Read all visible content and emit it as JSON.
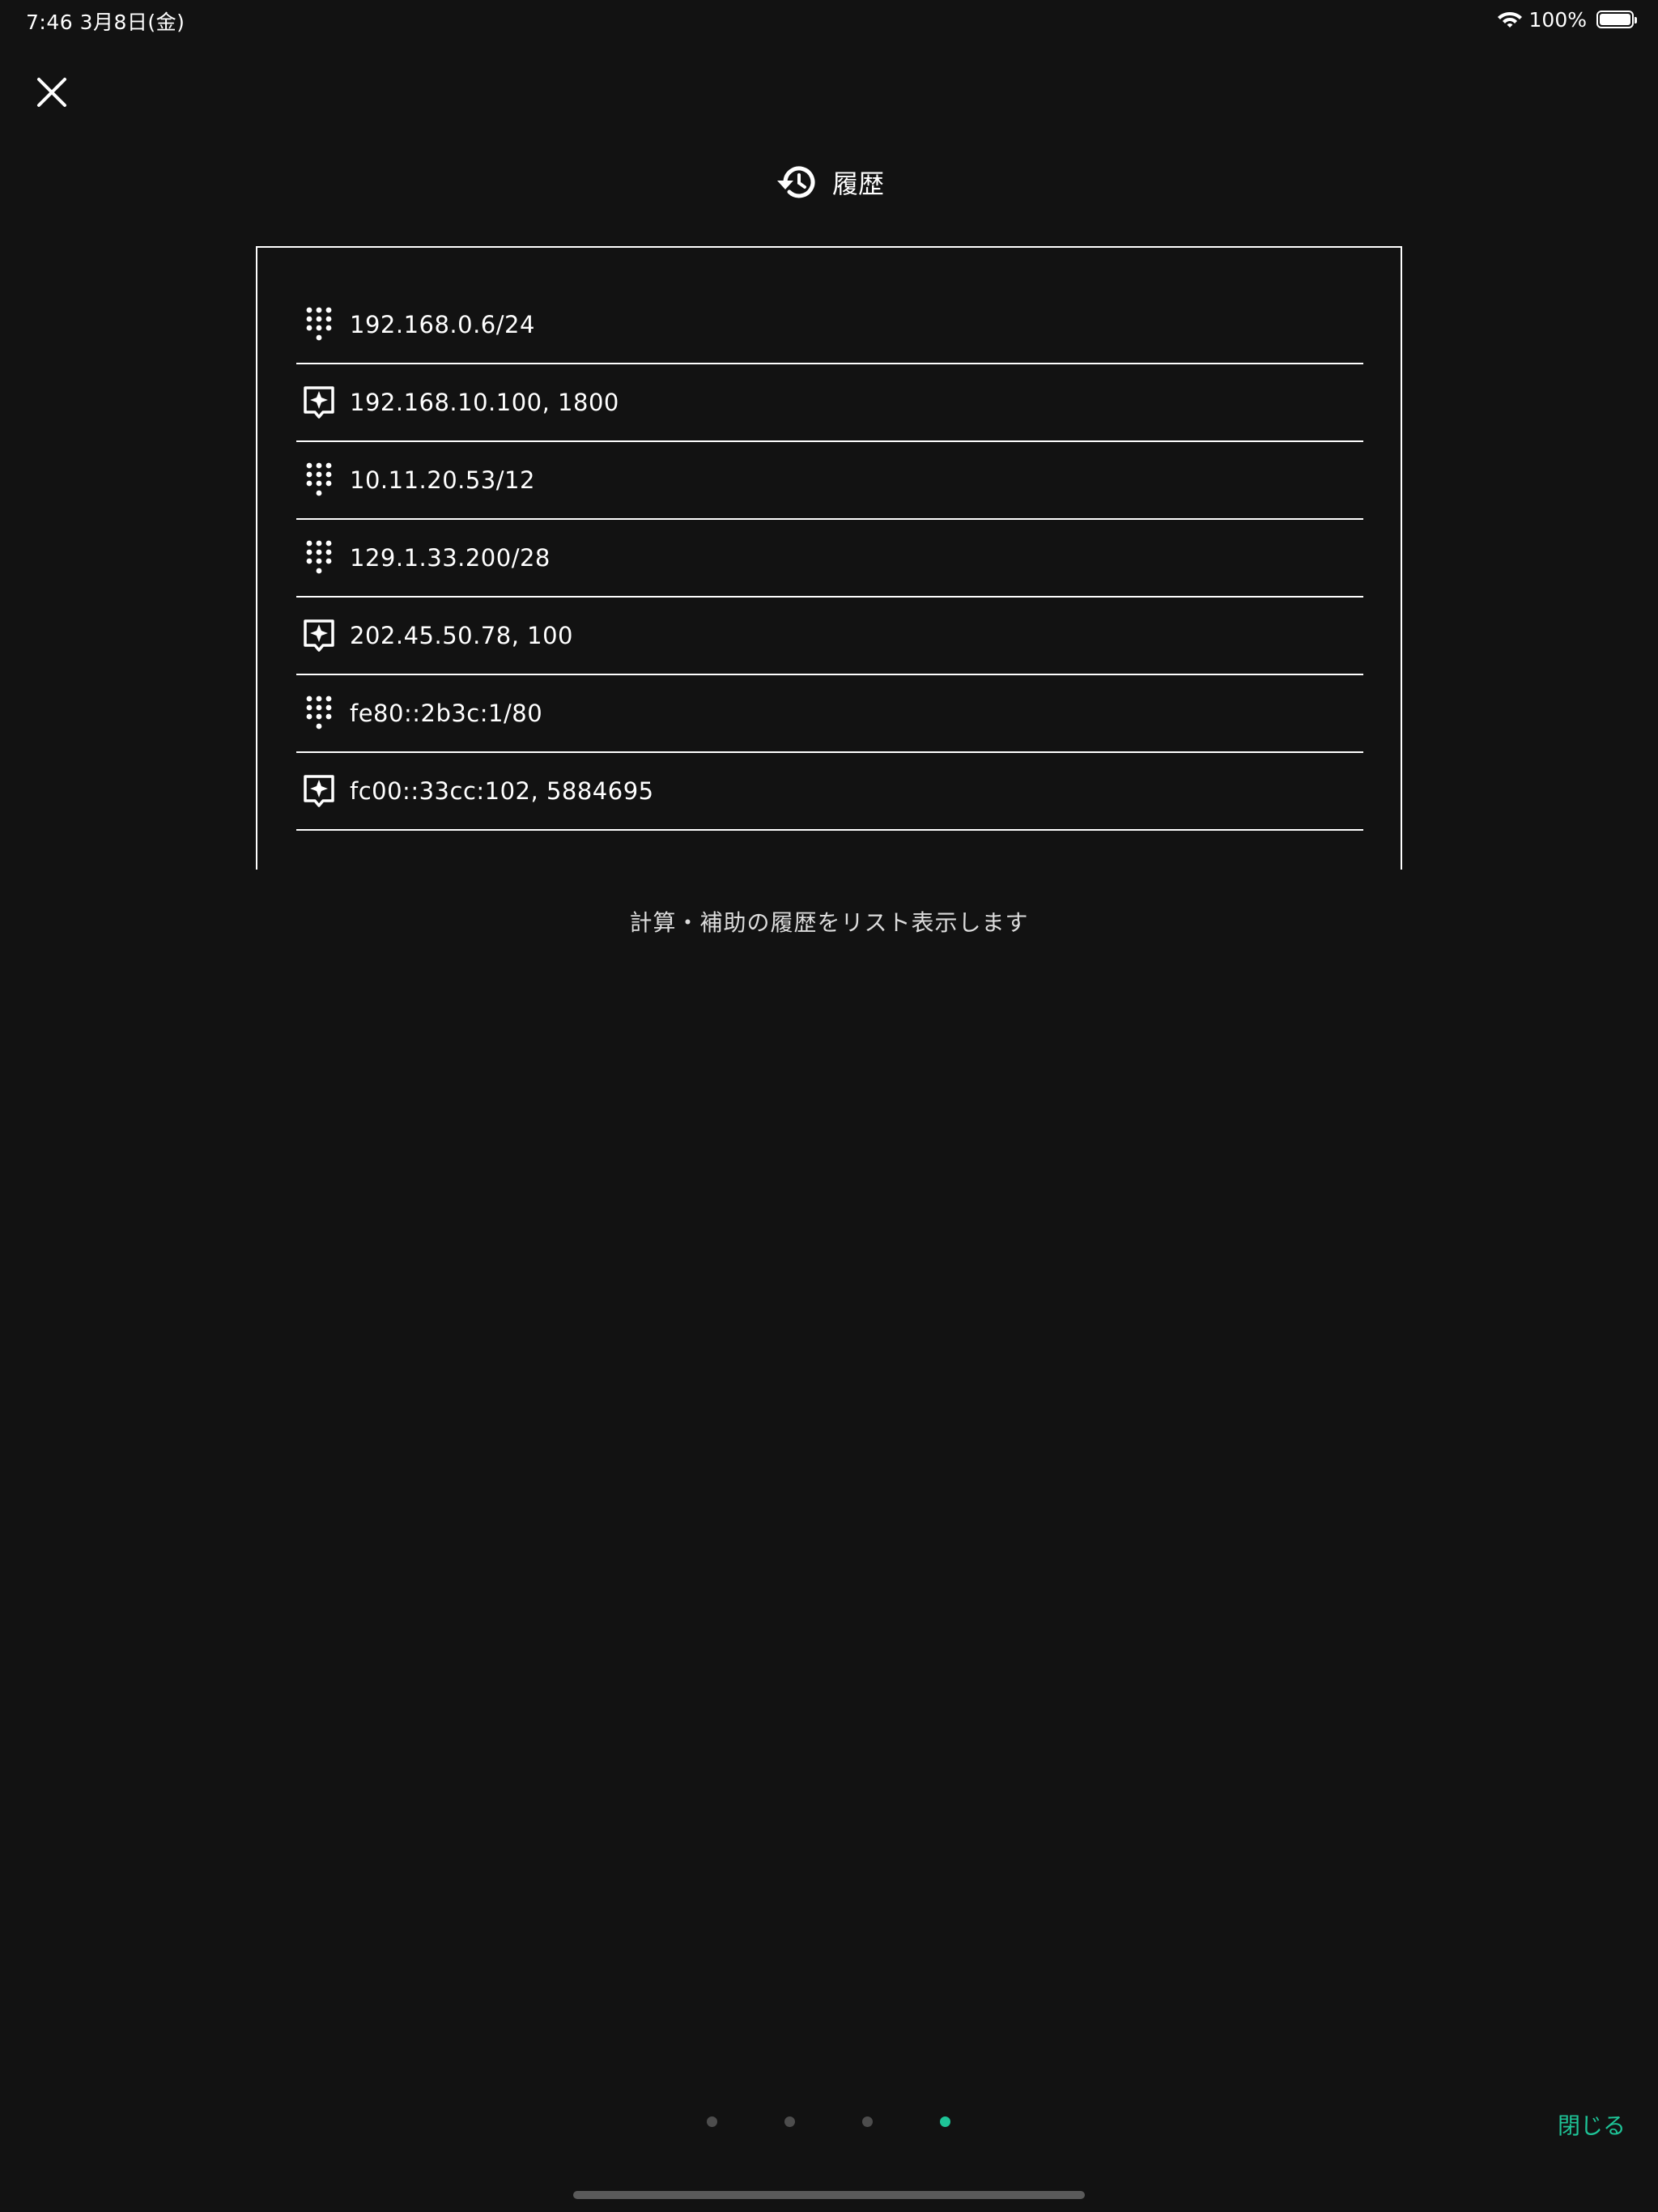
{
  "status_bar": {
    "time_date": "7:46   3月8日(金)",
    "battery_percent": "100%",
    "battery_level": 1.0,
    "icons": [
      "wifi-icon",
      "battery-icon"
    ]
  },
  "header": {
    "icon": "history-icon",
    "title": "履歴"
  },
  "history": {
    "items": [
      {
        "icon": "keypad-icon",
        "text": "192.168.0.6/24"
      },
      {
        "icon": "assist-icon",
        "text": "192.168.10.100, 1800"
      },
      {
        "icon": "keypad-icon",
        "text": "10.11.20.53/12"
      },
      {
        "icon": "keypad-icon",
        "text": "129.1.33.200/28"
      },
      {
        "icon": "assist-icon",
        "text": "202.45.50.78, 100"
      },
      {
        "icon": "keypad-icon",
        "text": "fe80::2b3c:1/80"
      },
      {
        "icon": "assist-icon",
        "text": "fc00::33cc:102, 5884695"
      }
    ]
  },
  "caption": "計算・補助の履歴をリスト表示します",
  "pager": {
    "page_count": 4,
    "active_index": 3
  },
  "close_button_label": "閉じる",
  "colors": {
    "background": "#121212",
    "accent": "#1ec497",
    "inactive_dot": "#4d4d4d"
  }
}
